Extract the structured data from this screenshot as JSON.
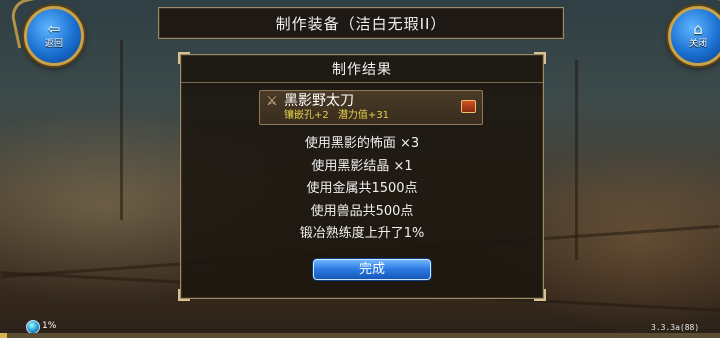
{
  "back_button": {
    "label": "返回",
    "icon": "back-arrow-icon"
  },
  "close_button": {
    "label": "关闭",
    "icon": "home-icon"
  },
  "title": "制作装备（洁白无瑕II）",
  "panel": {
    "header": "制作结果",
    "item": {
      "name": "黑影野太刀",
      "icon": "sword-icon",
      "stats": [
        "镶嵌孔+2",
        "潜力值+31"
      ]
    },
    "results": [
      "使用黑影的怖面 ×3",
      "使用黑影结晶 ×1",
      "使用金属共1500点",
      "使用兽品共500点",
      "锻冶熟练度上升了1%"
    ],
    "confirm_label": "完成"
  },
  "status": {
    "percent": "1%",
    "progress": 0.01,
    "version": "3.3.3a(88)"
  },
  "colors": {
    "frame_gold": "#c9a24b",
    "button_blue": "#2a78e0",
    "stats_yellow": "#e6d24a",
    "panel_bg": "#1c1610"
  }
}
